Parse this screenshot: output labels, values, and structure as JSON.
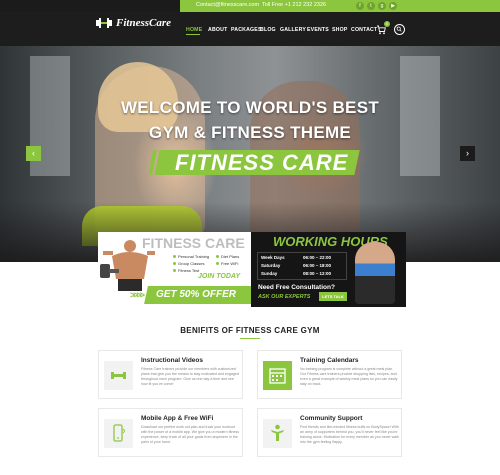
{
  "topbar": {
    "email": "Contact@fitnesscare.com",
    "phone": "Toll Free +1 212 232 2326",
    "social": [
      "facebook",
      "twitter",
      "google-plus",
      "youtube"
    ]
  },
  "brand": {
    "name": "FitnessCare"
  },
  "nav": {
    "items": [
      "HOME",
      "ABOUT",
      "PACKAGES",
      "BLOG",
      "GALLERY",
      "EVENTS",
      "SHOP",
      "CONTACT"
    ],
    "cart_count": "0"
  },
  "hero": {
    "line1": "WELCOME TO WORLD'S BEST",
    "line2": "GYM & FITNESS THEME",
    "banner": "FITNESS CARE",
    "prev": "‹",
    "next": "›"
  },
  "promo_left": {
    "title": "FITNESS CARE",
    "features": [
      "Personal Training",
      "Diet Plans",
      "Group Classes",
      "Free WiFi",
      "Fitness Test"
    ],
    "cta": "JOIN TODAY",
    "offer": "GET 50% OFFER"
  },
  "promo_right": {
    "title": "WORKING HOURS",
    "schedule": [
      {
        "day": "Week Days",
        "time": "06:00 – 22:00"
      },
      {
        "day": "Saturday",
        "time": "06:00 – 18:00"
      },
      {
        "day": "Sunday",
        "time": "08:00 – 12:00"
      }
    ],
    "consult": "Need Free Consultation?",
    "experts": "ASK OUR EXPERTS",
    "talk": "LETS TALK"
  },
  "benefits": {
    "title": "BENIFITS OF FITNESS CARE GYM",
    "items": [
      {
        "name": "Instructional Videos",
        "icon": "dumbbell-icon",
        "desc": "Fitness Care trainers provide our members with customized plans that give you the means to stay motivated and engaged throughout each program. Give us one day a time and see how fit you've come!"
      },
      {
        "name": "Training Calendars",
        "icon": "calendar-icon",
        "desc": "No training program is complete without a great meal plan. Our Fitness care trainers provide shopping lists, recipes, and even a great example of weekly meal plans so you can easily stay on track."
      },
      {
        "name": "Mobile App & Free WiFi",
        "icon": "mobile-app-icon",
        "desc": "Download our perfect work out plan and track your workout with the power of a mobile app. We give you a modern fitness experience, keep track of all your goals from anywhere in the palm of your hand."
      },
      {
        "name": "Community Support",
        "icon": "community-icon",
        "desc": "Find friends and like-minded fitness buffs on BodySpace! With an army of supporters behind you, you'll never feel like you're training alone. Motivation for every member as you never walk into the gym feeling flappy."
      }
    ]
  },
  "colors": {
    "accent": "#8cc63f",
    "dark": "#1b1b1b"
  }
}
